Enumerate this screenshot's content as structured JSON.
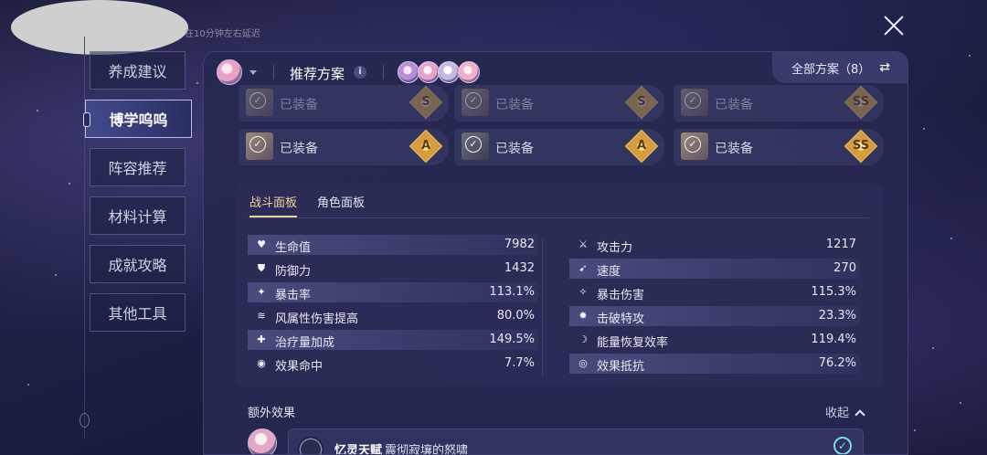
{
  "notice": "在10分钟左右延迟",
  "nav": {
    "items": [
      "养成建议",
      "博学呜呜",
      "阵容推荐",
      "材料计算",
      "成就攻略",
      "其他工具"
    ],
    "active": 1
  },
  "header": {
    "title": "推荐方案",
    "info": "i",
    "all_plans": "全部方案（8）",
    "swap": "⇄"
  },
  "relics": {
    "equipped_label": "已装备",
    "top_row": [
      "S",
      "S",
      "SS"
    ],
    "second_row": [
      "A",
      "A",
      "SS"
    ]
  },
  "tabs": {
    "battle": "战斗面板",
    "character": "角色面板"
  },
  "stats_left": [
    {
      "label": "生命值",
      "value": "7982",
      "icon": "heart-icon"
    },
    {
      "label": "防御力",
      "value": "1432",
      "icon": "shield-icon"
    },
    {
      "label": "暴击率",
      "value": "113.1%",
      "icon": "crit-icon"
    },
    {
      "label": "风属性伤害提高",
      "value": "80.0%",
      "icon": "wind-icon"
    },
    {
      "label": "治疗量加成",
      "value": "149.5%",
      "icon": "plus-icon"
    },
    {
      "label": "效果命中",
      "value": "7.7%",
      "icon": "effect-hit-icon"
    }
  ],
  "stats_right": [
    {
      "label": "攻击力",
      "value": "1217",
      "icon": "sword-icon"
    },
    {
      "label": "速度",
      "value": "270",
      "icon": "boot-icon"
    },
    {
      "label": "暴击伤害",
      "value": "115.3%",
      "icon": "crit-dmg-icon"
    },
    {
      "label": "击破特攻",
      "value": "23.3%",
      "icon": "break-icon"
    },
    {
      "label": "能量恢复效率",
      "value": "119.4%",
      "icon": "energy-icon"
    },
    {
      "label": "效果抵抗",
      "value": "76.2%",
      "icon": "effect-res-icon"
    }
  ],
  "extra": {
    "title": "额外效果",
    "collapse": "收起",
    "name": "忆灵天赋",
    "desc": "震彻寂壤的怒啸"
  }
}
